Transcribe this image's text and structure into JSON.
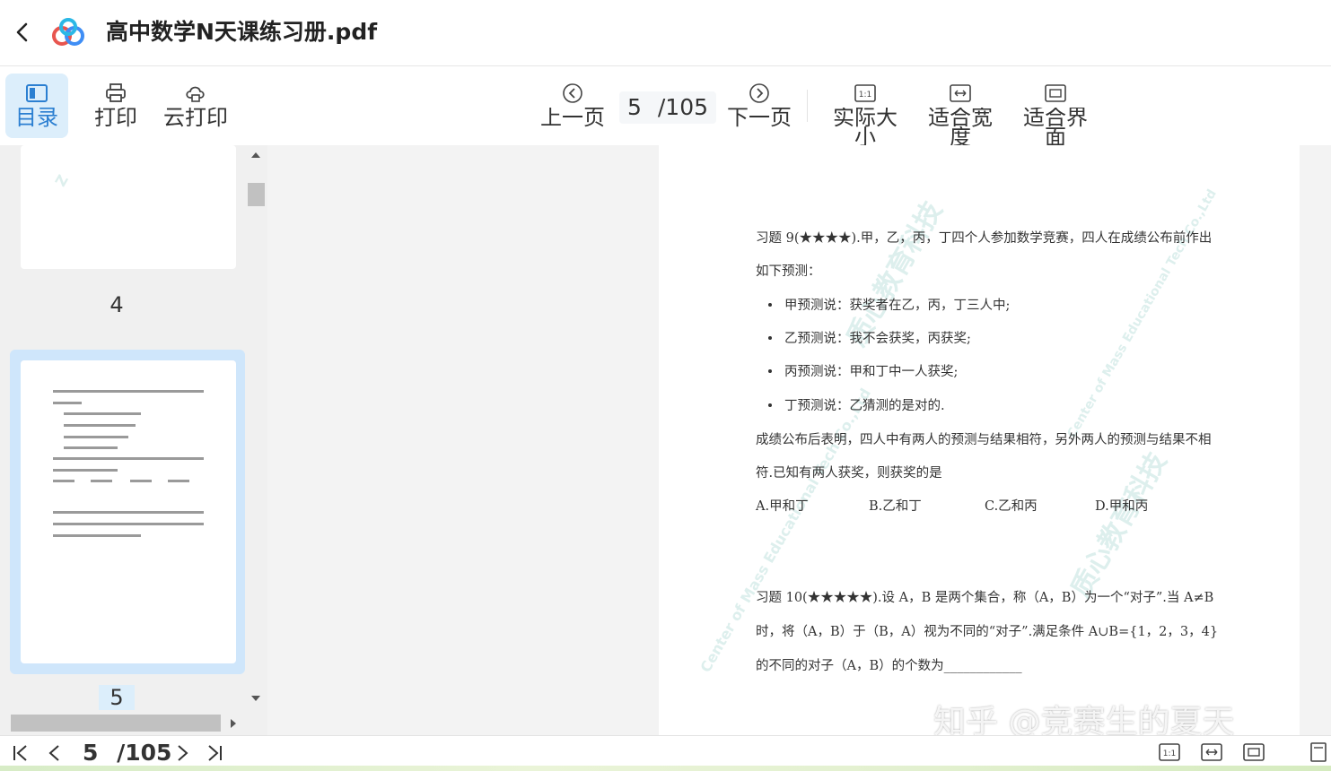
{
  "app": {
    "title": "高中数学N天课练习册.pdf"
  },
  "toolbar": {
    "toc_label": "目录",
    "print_label": "打印",
    "cloud_print_label": "云打印",
    "prev_label": "上一页",
    "next_label": "下一页",
    "actual_size_label": "实际大小",
    "fit_width_label": "适合宽度",
    "fit_page_label": "适合界面",
    "current_page": "5",
    "total_pages": "/105"
  },
  "sidebar": {
    "thumbnails": [
      {
        "label": "4"
      },
      {
        "label": "5",
        "selected": true
      }
    ]
  },
  "document": {
    "q9_title": "习题 9(★★★★).甲，乙，丙，丁四个人参加数学竞赛，四人在成绩公布前作出",
    "q9_line2": "如下预测：",
    "q9_items": [
      "甲预测说：获奖者在乙，丙，丁三人中;",
      "乙预测说：我不会获奖，丙获奖;",
      "丙预测说：甲和丁中一人获奖;",
      "丁预测说：乙猜测的是对的."
    ],
    "q9_line3": "成绩公布后表明，四人中有两人的预测与结果相符，另外两人的预测与结果不相",
    "q9_line4": "符.已知有两人获奖，则获奖的是",
    "q9_options": [
      "A.甲和丁",
      "B.乙和丁",
      "C.乙和丙",
      "D.甲和丙"
    ],
    "q10_line1": "习题 10(★★★★★).设 A，B 是两个集合，称（A，B）为一个“对子”.当 A≠B",
    "q10_line2": "时，将（A，B）于（B，A）视为不同的“对子”.满足条件 A∪B={1，2，3，4}",
    "q10_line3": "的不同的对子（A，B）的个数为____________",
    "watermarks": [
      "质心教育科技",
      "Center of Mass Educational Tech Co.,Ltd"
    ]
  },
  "overlay": {
    "zhihu": "知乎 @竞赛生的夏天"
  },
  "statusbar": {
    "page": "5",
    "total": "/105"
  },
  "colors": {
    "accent": "#2b7fd1",
    "active_bg": "#dceefb",
    "selection": "#cfe6fb"
  }
}
